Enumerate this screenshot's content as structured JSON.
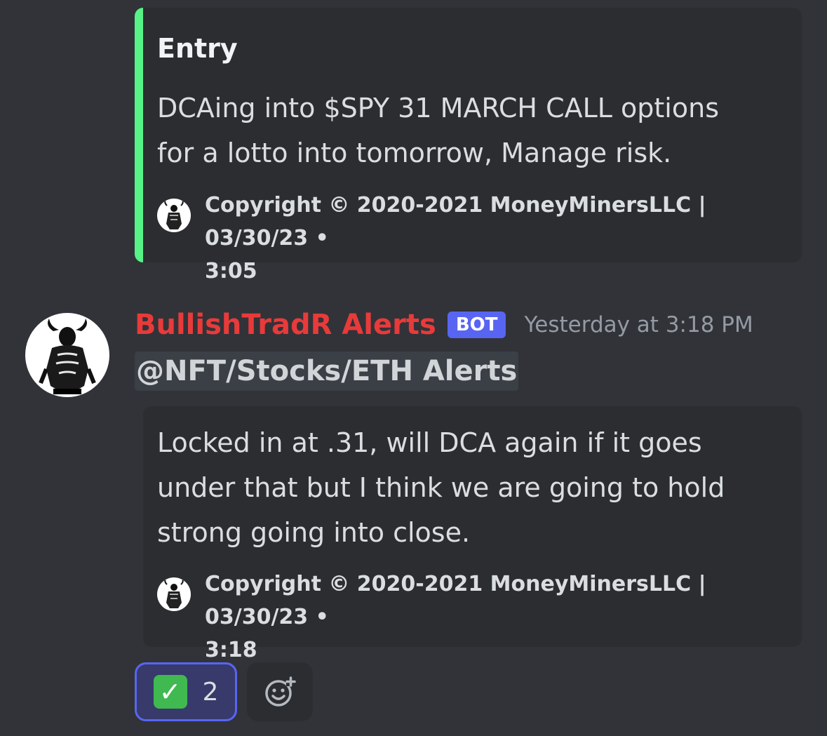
{
  "embed_1": {
    "title": "Entry",
    "description": "DCAing into $SPY 31 MARCH CALL options\nfor a lotto into tomorrow, Manage risk.",
    "footer_text": "Copyright © 2020-2021 MoneyMinersLLC | 03/30/23",
    "footer_time": "3:05",
    "accent_color": "#57f287"
  },
  "message": {
    "username": "BullishTradR Alerts",
    "bot_tag": "BOT",
    "timestamp": "Yesterday at 3:18 PM",
    "mention": "@NFT/Stocks/ETH Alerts",
    "username_color": "#e93a3a"
  },
  "embed_2": {
    "description": "Locked in at .31, will DCA again if it goes\nunder that but I think we are going to hold\nstrong going into close.",
    "footer_text": "Copyright © 2020-2021 MoneyMinersLLC | 03/30/23",
    "footer_time": "3:18"
  },
  "reactions": {
    "check": {
      "icon": "check-mark-button-icon",
      "count": "2"
    },
    "add_reaction_icon": "add-reaction-icon"
  }
}
